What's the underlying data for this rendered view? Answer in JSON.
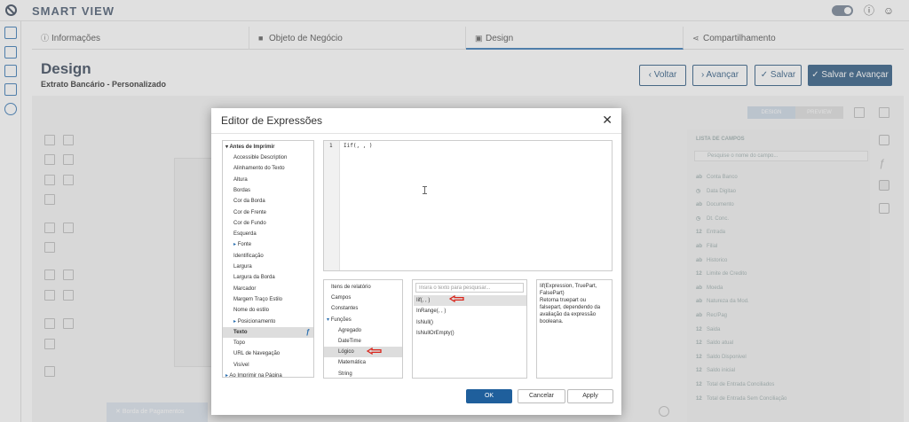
{
  "app": {
    "title": "SMART VIEW"
  },
  "tabs": [
    {
      "label": "Informações",
      "icon": "info-icon"
    },
    {
      "label": "Objeto de Negócio",
      "icon": "briefcase-icon"
    },
    {
      "label": "Design",
      "icon": "image-icon"
    },
    {
      "label": "Compartilhamento",
      "icon": "share-icon"
    }
  ],
  "page": {
    "title": "Design",
    "subtitle": "Extrato Bancário - Personalizado"
  },
  "actions": {
    "back": "Voltar",
    "next": "Avançar",
    "save": "Salvar",
    "save_next": "Salvar e Avançar"
  },
  "background": {
    "design_tab": "DESIGN",
    "preview_tab": "PREVIEW",
    "fields_title": "LISTA DE CAMPOS",
    "fields_search": "Pesquise o nome do campo...",
    "fields": [
      {
        "type": "ab",
        "name": "Conta Banco"
      },
      {
        "type": "clock",
        "name": "Data Digitao"
      },
      {
        "type": "ab",
        "name": "Documento"
      },
      {
        "type": "clock",
        "name": "Dt. Conc."
      },
      {
        "type": "12",
        "name": "Entrada"
      },
      {
        "type": "ab",
        "name": "Filial"
      },
      {
        "type": "ab",
        "name": "Historico"
      },
      {
        "type": "12",
        "name": "Limite de Credito"
      },
      {
        "type": "ab",
        "name": "Moeda"
      },
      {
        "type": "ab",
        "name": "Natureza da Mod."
      },
      {
        "type": "ab",
        "name": "Rec/Pag"
      },
      {
        "type": "12",
        "name": "Saida"
      },
      {
        "type": "12",
        "name": "Saldo atual"
      },
      {
        "type": "12",
        "name": "Saldo Disponivel"
      },
      {
        "type": "12",
        "name": "Saldo inicial"
      },
      {
        "type": "12",
        "name": "Total de Entrada Conciliados"
      },
      {
        "type": "12",
        "name": "Total de Entrada Sem Conciliação"
      }
    ],
    "bottom_band": "Borda de Pagamentos"
  },
  "dialog": {
    "title": "Editor de Expressões",
    "properties": {
      "header": "Antes de Imprimir",
      "items": [
        {
          "label": "Accessible Description"
        },
        {
          "label": "Alinhamento do Texto"
        },
        {
          "label": "Altura"
        },
        {
          "label": "Bordas"
        },
        {
          "label": "Cor da Borda"
        },
        {
          "label": "Cor de Frente"
        },
        {
          "label": "Cor de Fundo"
        },
        {
          "label": "Esquerda"
        },
        {
          "label": "Fonte",
          "expandable": true
        },
        {
          "label": "Identificação"
        },
        {
          "label": "Largura"
        },
        {
          "label": "Largura da Borda"
        },
        {
          "label": "Marcador"
        },
        {
          "label": "Margem Traço Estilo"
        },
        {
          "label": "Nome do estilo"
        },
        {
          "label": "Posicionamento",
          "expandable": true
        },
        {
          "label": "Texto",
          "selected": true
        },
        {
          "label": "Topo"
        },
        {
          "label": "URL de Navegação"
        },
        {
          "label": "Visível"
        },
        {
          "label": "Ao Imprimir na Página",
          "expandable": true
        }
      ]
    },
    "editor": {
      "line_number": "1",
      "code": "Iif(, , )"
    },
    "categories": [
      {
        "label": "Itens de relatório",
        "level": 1
      },
      {
        "label": "Campos",
        "level": 1
      },
      {
        "label": "Constantes",
        "level": 1
      },
      {
        "label": "Funções",
        "level": 1,
        "expanded": true
      },
      {
        "label": "Agregado",
        "level": 2
      },
      {
        "label": "DateTime",
        "level": 2
      },
      {
        "label": "Lógico",
        "level": 2,
        "selected": true
      },
      {
        "label": "Matemática",
        "level": 2
      },
      {
        "label": "String",
        "level": 2
      }
    ],
    "function_search": {
      "placeholder": "Insira o texto para pesquisar...",
      "value": ""
    },
    "functions": [
      {
        "label": "Iif(, , )",
        "selected": true
      },
      {
        "label": "InRange(, , )"
      },
      {
        "label": "IsNull()"
      },
      {
        "label": "IsNullOrEmpty()"
      }
    ],
    "description": "Iif(Expression, TruePart, FalsePart)\nRetorna truepart ou falsepart, dependendo da avaliação da expressão booleana.",
    "buttons": {
      "ok": "OK",
      "cancel": "Cancelar",
      "apply": "Apply"
    },
    "annotation_color": "#d9261c"
  }
}
